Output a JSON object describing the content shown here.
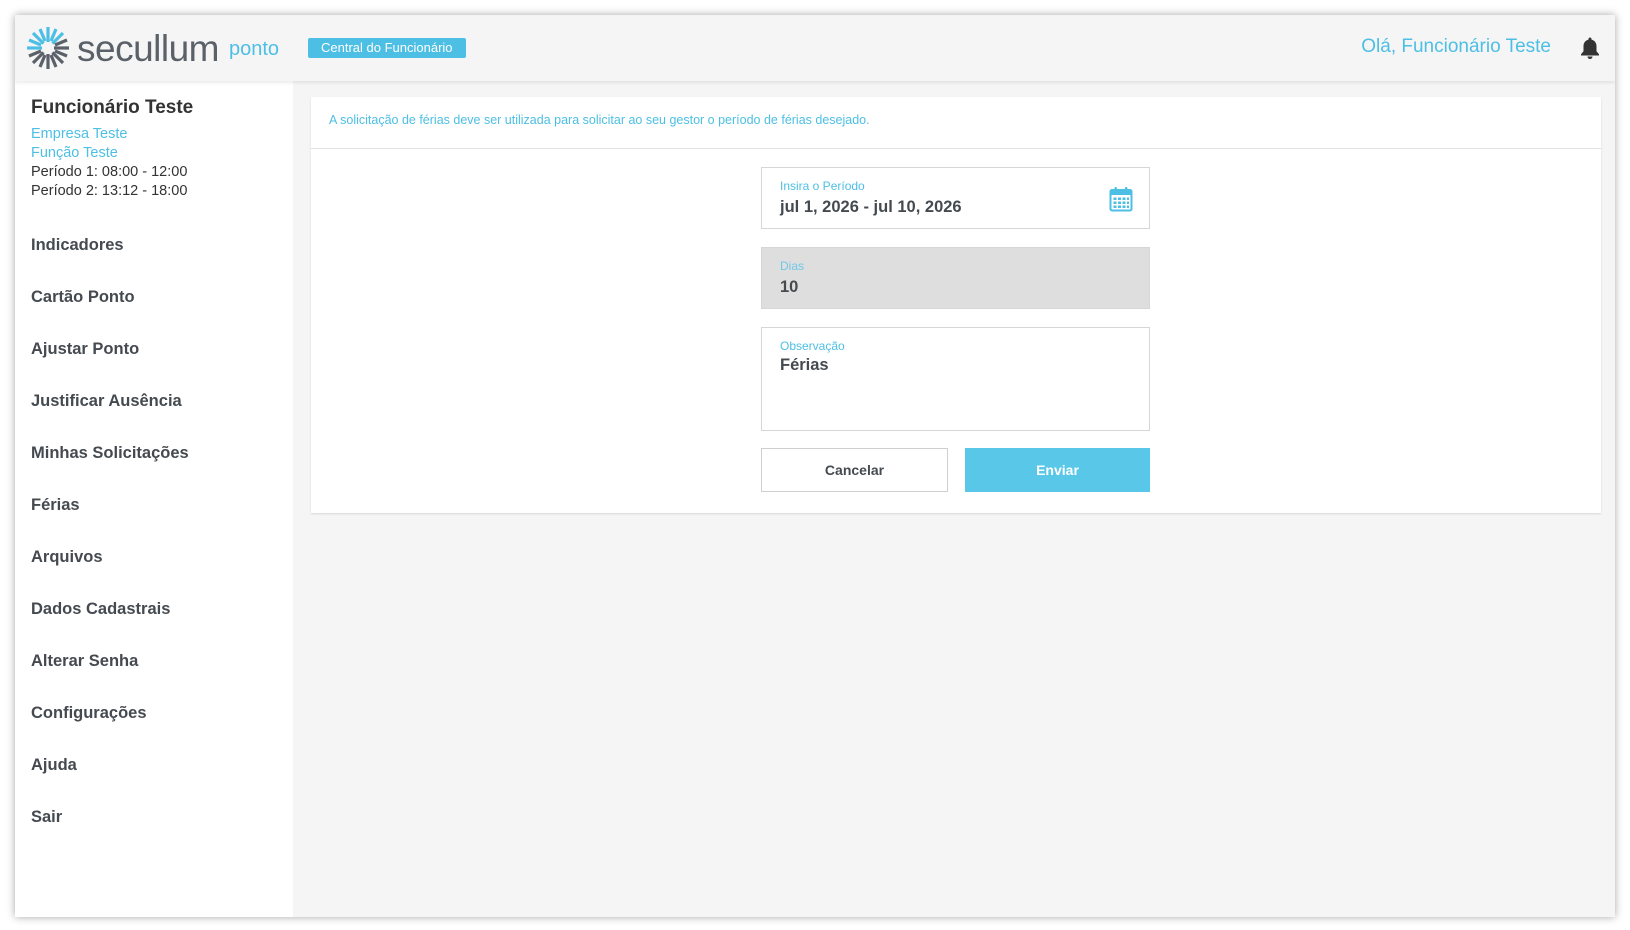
{
  "header": {
    "logo_text": "secullum",
    "logo_sub": "ponto",
    "badge": "Central do Funcionário",
    "greeting": "Olá, Funcionário Teste"
  },
  "icons": {
    "logo": "secullum-starburst-logo",
    "notifications": "bell-icon",
    "calendar": "calendar-icon"
  },
  "employee": {
    "name": "Funcionário Teste",
    "company": "Empresa Teste",
    "role": "Função Teste",
    "period1": "Período 1: 08:00 - 12:00",
    "period2": "Período 2: 13:12 - 18:00"
  },
  "menu": [
    {
      "label": "Indicadores"
    },
    {
      "label": "Cartão Ponto"
    },
    {
      "label": "Ajustar Ponto"
    },
    {
      "label": "Justificar Ausência"
    },
    {
      "label": "Minhas Solicitações"
    },
    {
      "label": "Férias"
    },
    {
      "label": "Arquivos"
    },
    {
      "label": "Dados Cadastrais"
    },
    {
      "label": "Alterar Senha"
    },
    {
      "label": "Configurações"
    },
    {
      "label": "Ajuda"
    },
    {
      "label": "Sair"
    }
  ],
  "form": {
    "info": "A solicitação de férias deve ser utilizada para solicitar ao seu gestor o período de férias desejado.",
    "period_label": "Insira o Período",
    "period_value": "jul 1, 2026 - jul 10, 2026",
    "days_label": "Dias",
    "days_value": "10",
    "obs_label": "Observação",
    "obs_value": "Férias",
    "cancel_label": "Cancelar",
    "send_label": "Enviar"
  },
  "colors": {
    "accent": "#4dbfe4",
    "send_button": "#58c7e8",
    "text_dark": "#444a50",
    "disabled_field": "#dedede"
  }
}
